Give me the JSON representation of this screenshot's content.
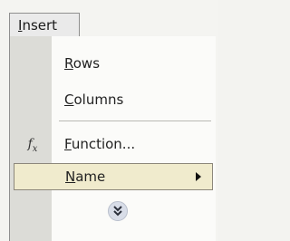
{
  "menu": {
    "title_prefix": "I",
    "title_rest": "nsert"
  },
  "items": {
    "rows": {
      "acc": "R",
      "rest": "ows"
    },
    "columns": {
      "acc": "C",
      "rest": "olumns"
    },
    "function": {
      "acc": "F",
      "rest": "unction...",
      "icon": "fx-icon"
    },
    "name": {
      "acc": "N",
      "rest": "ame",
      "has_submenu": true,
      "highlighted": true
    }
  },
  "expand": {
    "icon": "double-chevron-down-icon"
  },
  "colors": {
    "highlight_bg": "#f0ebcd",
    "gutter": "#dcdcd7",
    "menu_bg": "#fbfbf9"
  }
}
